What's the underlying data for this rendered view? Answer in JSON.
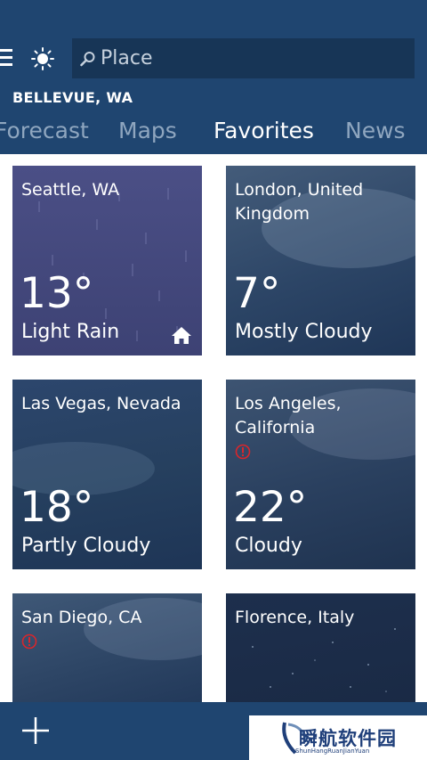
{
  "header": {
    "menu_icon": "hamburger-icon",
    "weather_icon": "sun-icon",
    "search": {
      "placeholder": "Place",
      "icon": "search-icon"
    },
    "location": "BELLEVUE, WA"
  },
  "tabs": [
    {
      "label": "Forecast",
      "active": false
    },
    {
      "label": "Maps",
      "active": false
    },
    {
      "label": "Favorites",
      "active": true
    },
    {
      "label": "News",
      "active": false
    }
  ],
  "favorites": [
    {
      "city": "Seattle, WA",
      "temp": "13°",
      "condition": "Light Rain",
      "icon": "home-icon"
    },
    {
      "city": "London, United Kingdom",
      "temp": "7°",
      "condition": "Mostly Cloudy"
    },
    {
      "city": "Las Vegas, Nevada",
      "temp": "18°",
      "condition": "Partly Cloudy"
    },
    {
      "city": "Los Angeles, California",
      "temp": "22°",
      "condition": "Cloudy",
      "icon": "alert-icon"
    },
    {
      "city": "San Diego, CA",
      "temp": "",
      "condition": "",
      "icon": "alert-icon"
    },
    {
      "city": "Florence, Italy",
      "temp": "",
      "condition": ""
    }
  ],
  "bottom_bar": {
    "add_icon": "plus-icon"
  },
  "watermark": {
    "text": "瞬航软件园",
    "subtext": "ShunHangRuanJianYuan"
  },
  "colors": {
    "header": "#1f4570",
    "tab_active": "#ffffff",
    "tab_inactive": "#8fa6bf",
    "alert": "#d8262b"
  }
}
